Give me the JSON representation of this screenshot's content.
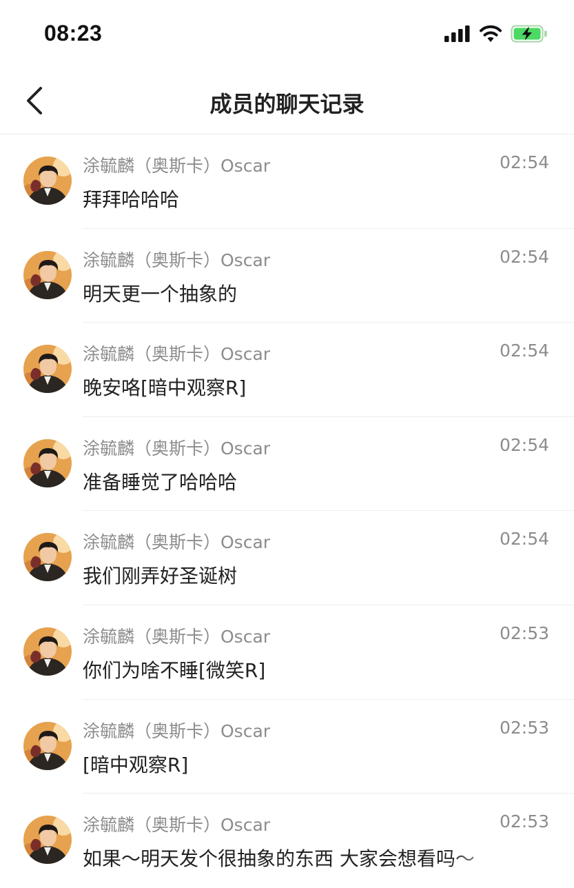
{
  "status_bar": {
    "time": "08:23",
    "icons": [
      "signal-icon",
      "wifi-icon",
      "battery-charging-icon"
    ],
    "battery_color": "#4cd964"
  },
  "nav": {
    "back_icon": "chevron-left-icon",
    "title": "成员的聊天记录"
  },
  "messages": [
    {
      "sender": "涂毓麟（奥斯卡）Oscar",
      "time": "02:54",
      "text": "拜拜哈哈哈"
    },
    {
      "sender": "涂毓麟（奥斯卡）Oscar",
      "time": "02:54",
      "text": "明天更一个抽象的"
    },
    {
      "sender": "涂毓麟（奥斯卡）Oscar",
      "time": "02:54",
      "text": "晚安咯[暗中观察R]"
    },
    {
      "sender": "涂毓麟（奥斯卡）Oscar",
      "time": "02:54",
      "text": "准备睡觉了哈哈哈"
    },
    {
      "sender": "涂毓麟（奥斯卡）Oscar",
      "time": "02:54",
      "text": "我们刚弄好圣诞树"
    },
    {
      "sender": "涂毓麟（奥斯卡）Oscar",
      "time": "02:53",
      "text": "你们为啥不睡[微笑R]"
    },
    {
      "sender": "涂毓麟（奥斯卡）Oscar",
      "time": "02:53",
      "text": "[暗中观察R]"
    },
    {
      "sender": "涂毓麟（奥斯卡）Oscar",
      "time": "02:53",
      "text": "如果～明天发个很抽象的东西 大家会想看吗～"
    }
  ]
}
